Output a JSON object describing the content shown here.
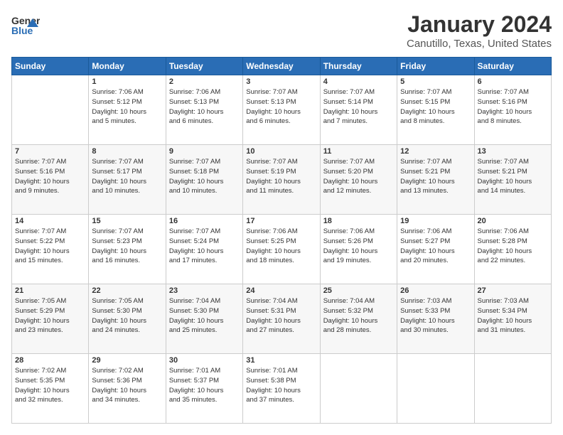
{
  "header": {
    "logo_line1": "General",
    "logo_line2": "Blue",
    "title": "January 2024",
    "subtitle": "Canutillo, Texas, United States"
  },
  "days_of_week": [
    "Sunday",
    "Monday",
    "Tuesday",
    "Wednesday",
    "Thursday",
    "Friday",
    "Saturday"
  ],
  "weeks": [
    [
      {
        "day": "",
        "info": ""
      },
      {
        "day": "1",
        "info": "Sunrise: 7:06 AM\nSunset: 5:12 PM\nDaylight: 10 hours\nand 5 minutes."
      },
      {
        "day": "2",
        "info": "Sunrise: 7:06 AM\nSunset: 5:13 PM\nDaylight: 10 hours\nand 6 minutes."
      },
      {
        "day": "3",
        "info": "Sunrise: 7:07 AM\nSunset: 5:13 PM\nDaylight: 10 hours\nand 6 minutes."
      },
      {
        "day": "4",
        "info": "Sunrise: 7:07 AM\nSunset: 5:14 PM\nDaylight: 10 hours\nand 7 minutes."
      },
      {
        "day": "5",
        "info": "Sunrise: 7:07 AM\nSunset: 5:15 PM\nDaylight: 10 hours\nand 8 minutes."
      },
      {
        "day": "6",
        "info": "Sunrise: 7:07 AM\nSunset: 5:16 PM\nDaylight: 10 hours\nand 8 minutes."
      }
    ],
    [
      {
        "day": "7",
        "info": "Sunrise: 7:07 AM\nSunset: 5:16 PM\nDaylight: 10 hours\nand 9 minutes."
      },
      {
        "day": "8",
        "info": "Sunrise: 7:07 AM\nSunset: 5:17 PM\nDaylight: 10 hours\nand 10 minutes."
      },
      {
        "day": "9",
        "info": "Sunrise: 7:07 AM\nSunset: 5:18 PM\nDaylight: 10 hours\nand 10 minutes."
      },
      {
        "day": "10",
        "info": "Sunrise: 7:07 AM\nSunset: 5:19 PM\nDaylight: 10 hours\nand 11 minutes."
      },
      {
        "day": "11",
        "info": "Sunrise: 7:07 AM\nSunset: 5:20 PM\nDaylight: 10 hours\nand 12 minutes."
      },
      {
        "day": "12",
        "info": "Sunrise: 7:07 AM\nSunset: 5:21 PM\nDaylight: 10 hours\nand 13 minutes."
      },
      {
        "day": "13",
        "info": "Sunrise: 7:07 AM\nSunset: 5:21 PM\nDaylight: 10 hours\nand 14 minutes."
      }
    ],
    [
      {
        "day": "14",
        "info": "Sunrise: 7:07 AM\nSunset: 5:22 PM\nDaylight: 10 hours\nand 15 minutes."
      },
      {
        "day": "15",
        "info": "Sunrise: 7:07 AM\nSunset: 5:23 PM\nDaylight: 10 hours\nand 16 minutes."
      },
      {
        "day": "16",
        "info": "Sunrise: 7:07 AM\nSunset: 5:24 PM\nDaylight: 10 hours\nand 17 minutes."
      },
      {
        "day": "17",
        "info": "Sunrise: 7:06 AM\nSunset: 5:25 PM\nDaylight: 10 hours\nand 18 minutes."
      },
      {
        "day": "18",
        "info": "Sunrise: 7:06 AM\nSunset: 5:26 PM\nDaylight: 10 hours\nand 19 minutes."
      },
      {
        "day": "19",
        "info": "Sunrise: 7:06 AM\nSunset: 5:27 PM\nDaylight: 10 hours\nand 20 minutes."
      },
      {
        "day": "20",
        "info": "Sunrise: 7:06 AM\nSunset: 5:28 PM\nDaylight: 10 hours\nand 22 minutes."
      }
    ],
    [
      {
        "day": "21",
        "info": "Sunrise: 7:05 AM\nSunset: 5:29 PM\nDaylight: 10 hours\nand 23 minutes."
      },
      {
        "day": "22",
        "info": "Sunrise: 7:05 AM\nSunset: 5:30 PM\nDaylight: 10 hours\nand 24 minutes."
      },
      {
        "day": "23",
        "info": "Sunrise: 7:04 AM\nSunset: 5:30 PM\nDaylight: 10 hours\nand 25 minutes."
      },
      {
        "day": "24",
        "info": "Sunrise: 7:04 AM\nSunset: 5:31 PM\nDaylight: 10 hours\nand 27 minutes."
      },
      {
        "day": "25",
        "info": "Sunrise: 7:04 AM\nSunset: 5:32 PM\nDaylight: 10 hours\nand 28 minutes."
      },
      {
        "day": "26",
        "info": "Sunrise: 7:03 AM\nSunset: 5:33 PM\nDaylight: 10 hours\nand 30 minutes."
      },
      {
        "day": "27",
        "info": "Sunrise: 7:03 AM\nSunset: 5:34 PM\nDaylight: 10 hours\nand 31 minutes."
      }
    ],
    [
      {
        "day": "28",
        "info": "Sunrise: 7:02 AM\nSunset: 5:35 PM\nDaylight: 10 hours\nand 32 minutes."
      },
      {
        "day": "29",
        "info": "Sunrise: 7:02 AM\nSunset: 5:36 PM\nDaylight: 10 hours\nand 34 minutes."
      },
      {
        "day": "30",
        "info": "Sunrise: 7:01 AM\nSunset: 5:37 PM\nDaylight: 10 hours\nand 35 minutes."
      },
      {
        "day": "31",
        "info": "Sunrise: 7:01 AM\nSunset: 5:38 PM\nDaylight: 10 hours\nand 37 minutes."
      },
      {
        "day": "",
        "info": ""
      },
      {
        "day": "",
        "info": ""
      },
      {
        "day": "",
        "info": ""
      }
    ]
  ]
}
